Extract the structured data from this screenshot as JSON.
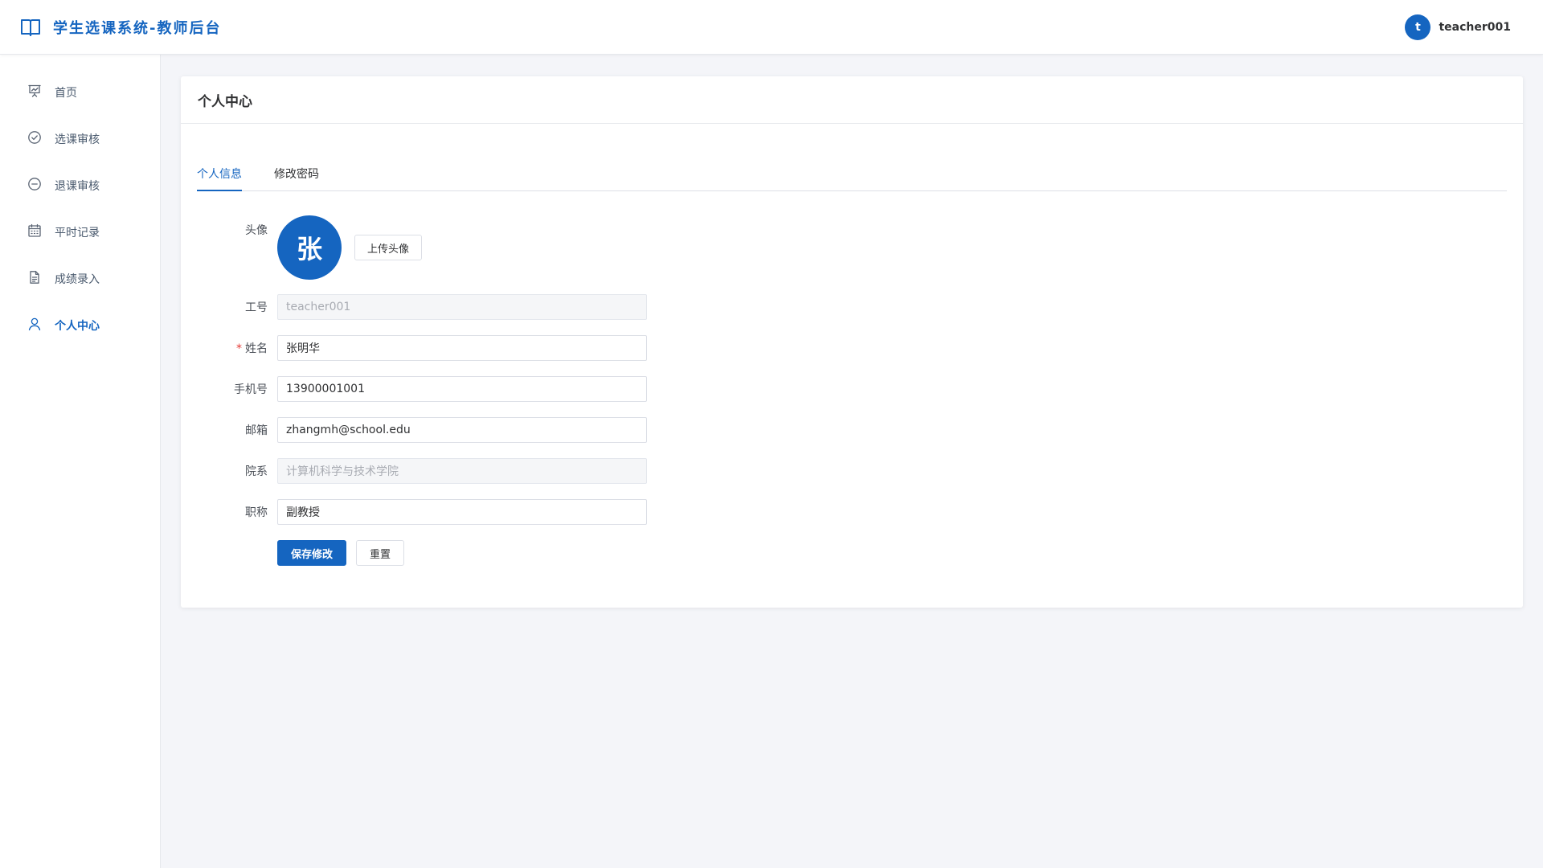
{
  "header": {
    "app_title": "学生选课系统-教师后台",
    "logo_icon": "book-icon",
    "user": {
      "avatar_letter": "t",
      "username": "teacher001"
    }
  },
  "sidebar": {
    "items": [
      {
        "label": "首页",
        "icon": "presentation-chart-icon"
      },
      {
        "label": "选课审核",
        "icon": "check-circle-icon"
      },
      {
        "label": "退课审核",
        "icon": "minus-circle-icon"
      },
      {
        "label": "平时记录",
        "icon": "calendar-icon"
      },
      {
        "label": "成绩录入",
        "icon": "document-icon"
      },
      {
        "label": "个人中心",
        "icon": "user-icon",
        "active": true
      }
    ]
  },
  "main": {
    "card_title": "个人中心",
    "tabs": [
      {
        "label": "个人信息",
        "active": true
      },
      {
        "label": "修改密码"
      }
    ],
    "form": {
      "avatar": {
        "label": "头像",
        "text": "张",
        "upload_label": "上传头像"
      },
      "fields": [
        {
          "label": "工号",
          "value": "teacher001",
          "disabled": true,
          "required": false
        },
        {
          "label": "姓名",
          "value": "张明华",
          "disabled": false,
          "required": true
        },
        {
          "label": "手机号",
          "value": "13900001001",
          "disabled": false,
          "required": false
        },
        {
          "label": "邮箱",
          "value": "zhangmh@school.edu",
          "disabled": false,
          "required": false
        },
        {
          "label": "院系",
          "value": "计算机科学与技术学院",
          "disabled": true,
          "required": false
        },
        {
          "label": "职称",
          "value": "副教授",
          "disabled": false,
          "required": false
        }
      ],
      "required_mark": "*",
      "save_label": "保存修改",
      "reset_label": "重置"
    }
  },
  "colors": {
    "primary": "#1565c0",
    "background": "#f4f5f9",
    "required": "#e53935"
  }
}
